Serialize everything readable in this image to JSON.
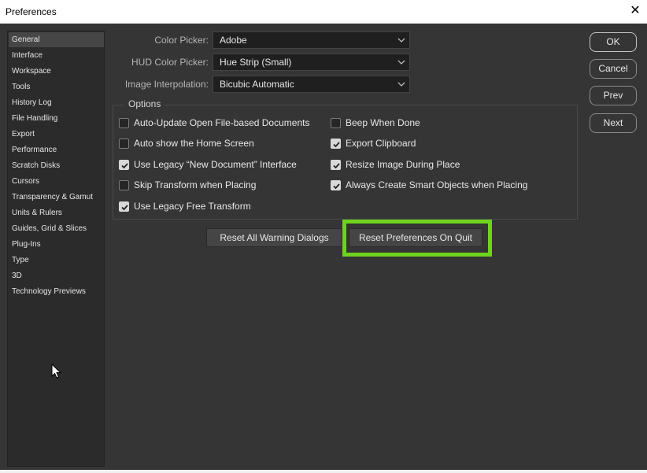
{
  "window": {
    "title": "Preferences",
    "close_glyph": "✕"
  },
  "sidebar": {
    "items": [
      {
        "label": "General",
        "active": true
      },
      {
        "label": "Interface"
      },
      {
        "label": "Workspace"
      },
      {
        "label": "Tools"
      },
      {
        "label": "History Log"
      },
      {
        "label": "File Handling"
      },
      {
        "label": "Export"
      },
      {
        "label": "Performance"
      },
      {
        "label": "Scratch Disks"
      },
      {
        "label": "Cursors"
      },
      {
        "label": "Transparency & Gamut"
      },
      {
        "label": "Units & Rulers"
      },
      {
        "label": "Guides, Grid & Slices"
      },
      {
        "label": "Plug-Ins"
      },
      {
        "label": "Type"
      },
      {
        "label": "3D"
      },
      {
        "label": "Technology Previews"
      }
    ]
  },
  "fields": {
    "color_picker": {
      "label": "Color Picker:",
      "value": "Adobe"
    },
    "hud_color_picker": {
      "label": "HUD Color Picker:",
      "value": "Hue Strip (Small)"
    },
    "image_interpolation": {
      "label": "Image Interpolation:",
      "value": "Bicubic Automatic"
    }
  },
  "options": {
    "legend": "Options",
    "items": [
      {
        "label": "Auto-Update Open File-based Documents",
        "checked": false
      },
      {
        "label": "Beep When Done",
        "checked": false
      },
      {
        "label": "Auto show the Home Screen",
        "checked": false
      },
      {
        "label": "Export Clipboard",
        "checked": true
      },
      {
        "label": "Use Legacy “New Document” Interface",
        "checked": true
      },
      {
        "label": "Resize Image During Place",
        "checked": true
      },
      {
        "label": "Skip Transform when Placing",
        "checked": false
      },
      {
        "label": "Always Create Smart Objects when Placing",
        "checked": true
      },
      {
        "label": "Use Legacy Free Transform",
        "checked": true
      }
    ]
  },
  "buttons": {
    "reset_warnings": "Reset All Warning Dialogs",
    "reset_prefs": "Reset Preferences On Quit",
    "ok": "OK",
    "cancel": "Cancel",
    "prev": "Prev",
    "next": "Next"
  },
  "colors": {
    "highlight": "#6ed31d",
    "panel_bg": "#353535",
    "sidebar_bg": "#2b2b2b"
  },
  "icons": {
    "close": "close-icon",
    "dropdown": "chevron-down-icon",
    "check": "check-icon",
    "cursor": "mouse-pointer-icon"
  }
}
